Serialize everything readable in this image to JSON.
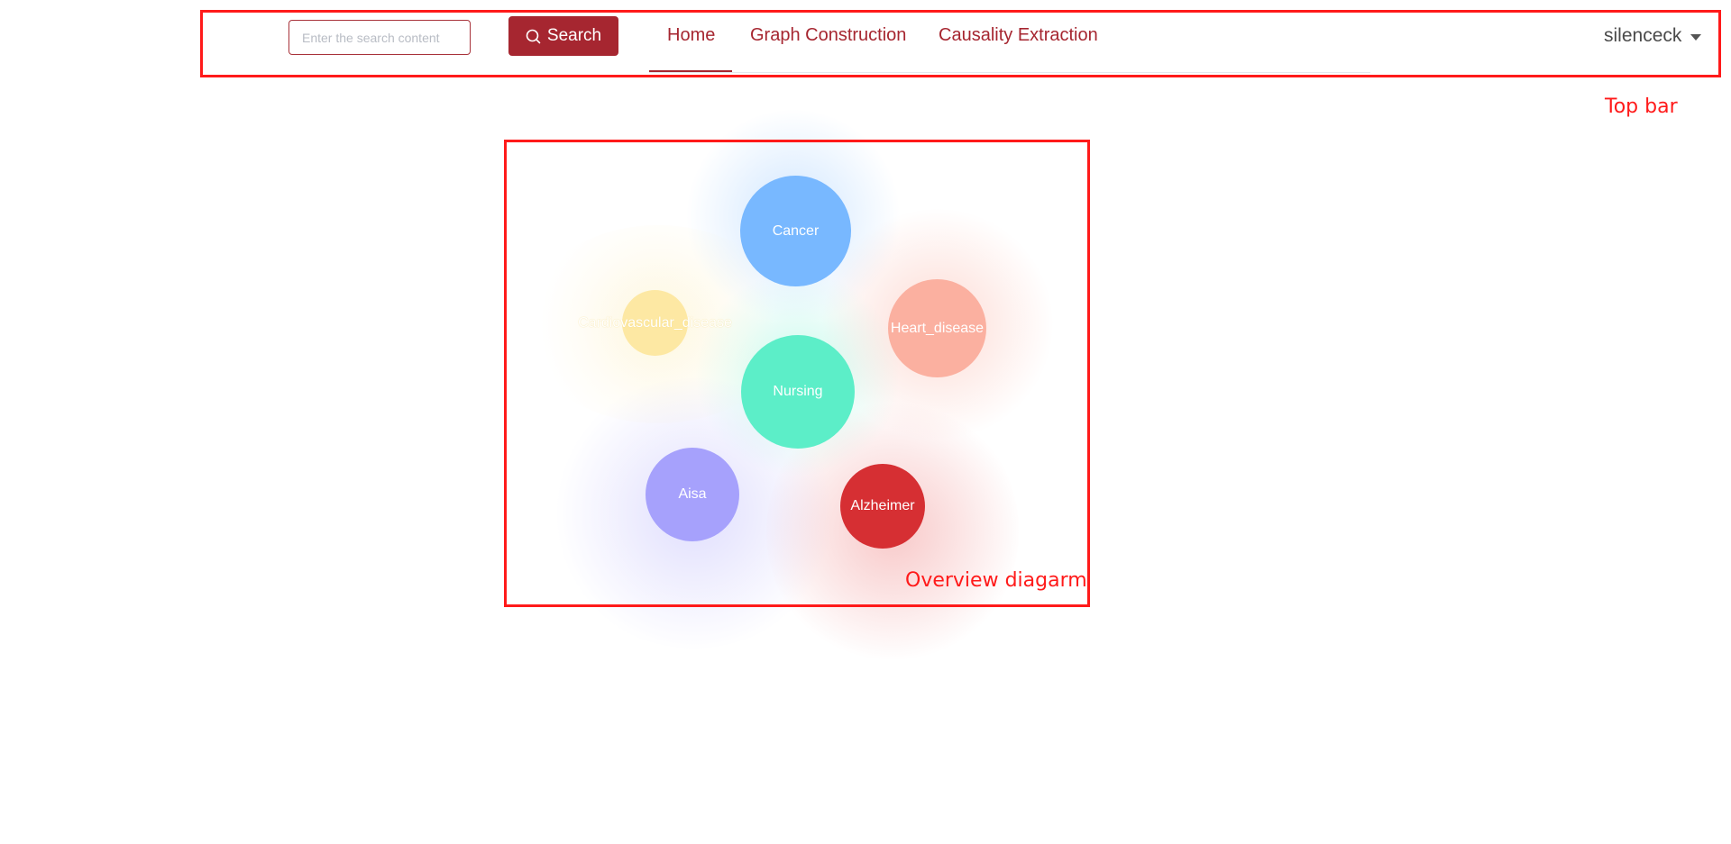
{
  "header": {
    "search": {
      "placeholder": "Enter the search content",
      "value": ""
    },
    "search_button_label": "Search",
    "nav": [
      {
        "label": "Home",
        "active": true
      },
      {
        "label": "Graph Construction",
        "active": false
      },
      {
        "label": "Causality Extraction",
        "active": false
      }
    ],
    "user": {
      "name": "silenceck"
    },
    "accent_color": "#a62630"
  },
  "graph": {
    "nodes": [
      {
        "label": "Cancer",
        "color": "#78b8ff"
      },
      {
        "label": "Cardiovascular_disease",
        "color": "#fde8a3"
      },
      {
        "label": "Heart_disease",
        "color": "#fbb0a0"
      },
      {
        "label": "Nursing",
        "color": "#5ceec8"
      },
      {
        "label": "Aisa",
        "color": "#a6a1fc"
      },
      {
        "label": "Alzheimer",
        "color": "#d62f33"
      }
    ]
  },
  "annotations": {
    "top_bar_label": "Top bar",
    "overview_label": "Overview diagarm",
    "color": "#ff1a1a"
  }
}
